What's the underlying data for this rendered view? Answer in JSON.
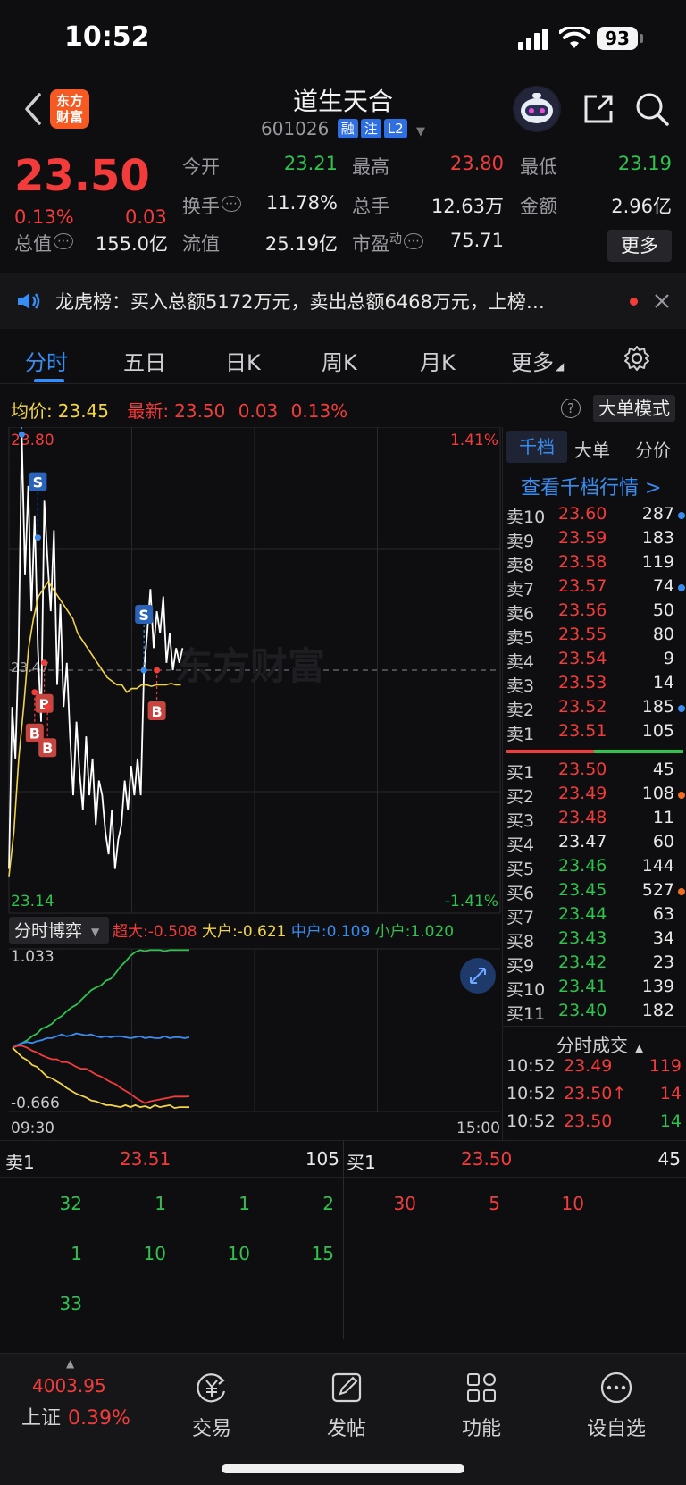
{
  "status_bar": {
    "time": "10:52",
    "battery": "93"
  },
  "header": {
    "logo_line1": "东方",
    "logo_line2": "财富",
    "stock_name": "道生天合",
    "code": "601026",
    "tags": [
      "融",
      "注",
      "L2"
    ]
  },
  "quote": {
    "last": "23.50",
    "pct": "0.13%",
    "chg": "0.03",
    "fields": [
      {
        "label": "今开",
        "value": "23.21",
        "color": "green"
      },
      {
        "label": "最高",
        "value": "23.80",
        "color": "red"
      },
      {
        "label": "最低",
        "value": "23.19",
        "color": "green"
      },
      {
        "label": "换手",
        "value": "11.78%",
        "color": "white"
      },
      {
        "label": "总手",
        "value": "12.63万",
        "color": "white"
      },
      {
        "label": "金额",
        "value": "2.96亿",
        "color": "white"
      },
      {
        "label": "总值",
        "value": "155.0亿",
        "color": "white"
      },
      {
        "label": "流值",
        "value": "25.19亿",
        "color": "white"
      },
      {
        "label": "市盈",
        "value": "75.71",
        "color": "white"
      }
    ],
    "pe_superscript": "动",
    "more_label": "更多"
  },
  "news": {
    "text": "龙虎榜：买入总额5172万元，卖出总额6468万元，上榜…"
  },
  "tabs": [
    "分时",
    "五日",
    "日K",
    "周K",
    "月K",
    "更多"
  ],
  "avg_bar": {
    "avg_label": "均价:",
    "avg_value": "23.45",
    "latest_label": "最新:",
    "latest_value": "23.50",
    "latest_chg": "0.03",
    "latest_pct": "0.13%",
    "help": "?",
    "big_mode": "大单模式"
  },
  "chart_data": {
    "type": "line",
    "title": "",
    "x_start": "09:30",
    "x_end": "15:00",
    "price_top": "23.80",
    "price_bottom": "23.14",
    "price_mid": "23.47",
    "pct_top": "1.41%",
    "pct_bottom": "-1.41%",
    "ylim": [
      23.14,
      23.8
    ],
    "series": [
      {
        "name": "",
        "color": "#ffffff",
        "values": [
          23.2,
          23.42,
          23.35,
          23.5,
          23.79,
          23.6,
          23.72,
          23.55,
          23.68,
          23.5,
          23.4,
          23.7,
          23.62,
          23.55,
          23.66,
          23.45,
          23.56,
          23.42,
          23.48,
          23.38,
          23.3,
          23.4,
          23.33,
          23.28,
          23.38,
          23.3,
          23.35,
          23.26,
          23.32,
          23.3,
          23.25,
          23.22,
          23.28,
          23.2,
          23.24,
          23.26,
          23.32,
          23.28,
          23.34,
          23.3,
          23.35,
          23.3,
          23.47,
          23.52,
          23.58,
          23.5,
          23.55,
          23.52,
          23.57,
          23.48,
          23.52,
          23.47,
          23.5,
          23.48,
          23.5
        ]
      },
      {
        "name": "",
        "color": "#f1d44a",
        "values": [
          23.19,
          23.25,
          23.35,
          23.42,
          23.5,
          23.54,
          23.57,
          23.58,
          23.59,
          23.58,
          23.57,
          23.56,
          23.55,
          23.54,
          23.52,
          23.51,
          23.5,
          23.49,
          23.48,
          23.47,
          23.46,
          23.455,
          23.45,
          23.45,
          23.44,
          23.445,
          23.445,
          23.45,
          23.45,
          23.448,
          23.45,
          23.45,
          23.45,
          23.452,
          23.45,
          23.45
        ]
      }
    ],
    "markers": [
      {
        "type": "S",
        "price": 23.79,
        "idx": 4
      },
      {
        "type": "S",
        "price": 23.65,
        "idx": 9
      },
      {
        "type": "S",
        "price": 23.47,
        "idx": 42
      },
      {
        "type": "B",
        "price": 23.44,
        "idx": 8
      },
      {
        "type": "B",
        "price": 23.48,
        "idx": 11
      },
      {
        "type": "B",
        "price": 23.42,
        "idx": 12
      },
      {
        "type": "B",
        "price": 23.47,
        "idx": 46
      }
    ]
  },
  "flow": {
    "title": "分时博弈",
    "super_label": "超大:",
    "super_value": "-0.508",
    "large_label": "大户:",
    "large_value": "-0.621",
    "mid_label": "中户:",
    "mid_value": "0.109",
    "small_label": "小户:",
    "small_value": "1.020",
    "top": "1.033",
    "bottom": "-0.666",
    "chart_data": {
      "type": "line",
      "ylim": [
        -0.666,
        1.033
      ],
      "series": [
        {
          "name": "小户",
          "color": "#2fc24e",
          "values": [
            0,
            0.02,
            0.05,
            0.08,
            0.12,
            0.15,
            0.2,
            0.22,
            0.25,
            0.3,
            0.33,
            0.38,
            0.42,
            0.45,
            0.5,
            0.55,
            0.6,
            0.63,
            0.65,
            0.7,
            0.72,
            0.78,
            0.85,
            0.9,
            0.96,
            1.0,
            1.02,
            1.01,
            1.02,
            1.02,
            1.02,
            1.01,
            1.02,
            1.02,
            1.02,
            1.02,
            1.02
          ]
        },
        {
          "name": "中户",
          "color": "#3a8df0",
          "values": [
            0,
            0.03,
            0.05,
            0.06,
            0.05,
            0.07,
            0.08,
            0.1,
            0.1,
            0.12,
            0.14,
            0.12,
            0.13,
            0.15,
            0.14,
            0.13,
            0.14,
            0.12,
            0.11,
            0.12,
            0.11,
            0.12,
            0.12,
            0.11,
            0.1,
            0.11,
            0.12,
            0.1,
            0.11,
            0.1,
            0.1,
            0.12,
            0.1,
            0.11,
            0.11,
            0.1,
            0.11
          ]
        },
        {
          "name": "超大",
          "color": "#f23c3c",
          "values": [
            0,
            0.02,
            0.02,
            0.0,
            -0.03,
            -0.05,
            -0.08,
            -0.1,
            -0.12,
            -0.12,
            -0.15,
            -0.15,
            -0.17,
            -0.2,
            -0.22,
            -0.22,
            -0.25,
            -0.28,
            -0.3,
            -0.33,
            -0.36,
            -0.38,
            -0.42,
            -0.45,
            -0.48,
            -0.52,
            -0.55,
            -0.58,
            -0.56,
            -0.55,
            -0.54,
            -0.53,
            -0.52,
            -0.51,
            -0.51,
            -0.51,
            -0.508
          ]
        },
        {
          "name": "大户",
          "color": "#f1d44a",
          "values": [
            0,
            -0.05,
            -0.1,
            -0.13,
            -0.18,
            -0.2,
            -0.25,
            -0.3,
            -0.32,
            -0.35,
            -0.38,
            -0.42,
            -0.45,
            -0.48,
            -0.5,
            -0.52,
            -0.55,
            -0.56,
            -0.58,
            -0.6,
            -0.6,
            -0.61,
            -0.62,
            -0.6,
            -0.62,
            -0.6,
            -0.62,
            -0.61,
            -0.63,
            -0.6,
            -0.62,
            -0.61,
            -0.6,
            -0.63,
            -0.62,
            -0.62,
            -0.621
          ]
        }
      ]
    }
  },
  "order_book": {
    "tabs": [
      "千档",
      "大单",
      "分价"
    ],
    "link": "查看千档行情 >",
    "asks": [
      {
        "label": "卖10",
        "price": "23.60",
        "vol": "287",
        "dot": "#3a8df0"
      },
      {
        "label": "卖9",
        "price": "23.59",
        "vol": "183",
        "dot": ""
      },
      {
        "label": "卖8",
        "price": "23.58",
        "vol": "119",
        "dot": ""
      },
      {
        "label": "卖7",
        "price": "23.57",
        "vol": "74",
        "dot": "#3a8df0"
      },
      {
        "label": "卖6",
        "price": "23.56",
        "vol": "50",
        "dot": ""
      },
      {
        "label": "卖5",
        "price": "23.55",
        "vol": "80",
        "dot": ""
      },
      {
        "label": "卖4",
        "price": "23.54",
        "vol": "9",
        "dot": ""
      },
      {
        "label": "卖3",
        "price": "23.53",
        "vol": "14",
        "dot": ""
      },
      {
        "label": "卖2",
        "price": "23.52",
        "vol": "185",
        "dot": "#3a8df0"
      },
      {
        "label": "卖1",
        "price": "23.51",
        "vol": "105",
        "dot": ""
      }
    ],
    "bids": [
      {
        "label": "买1",
        "price": "23.50",
        "vol": "45",
        "dot": "",
        "color": "red"
      },
      {
        "label": "买2",
        "price": "23.49",
        "vol": "108",
        "dot": "#f07020",
        "color": "red"
      },
      {
        "label": "买3",
        "price": "23.48",
        "vol": "11",
        "dot": "",
        "color": "red"
      },
      {
        "label": "买4",
        "price": "23.47",
        "vol": "60",
        "dot": "",
        "color": "white"
      },
      {
        "label": "买5",
        "price": "23.46",
        "vol": "144",
        "dot": "",
        "color": "green"
      },
      {
        "label": "买6",
        "price": "23.45",
        "vol": "527",
        "dot": "#f07020",
        "color": "green"
      },
      {
        "label": "买7",
        "price": "23.44",
        "vol": "63",
        "dot": "",
        "color": "green"
      },
      {
        "label": "买8",
        "price": "23.43",
        "vol": "34",
        "dot": "",
        "color": "green"
      },
      {
        "label": "买9",
        "price": "23.42",
        "vol": "23",
        "dot": "",
        "color": "green"
      },
      {
        "label": "买10",
        "price": "23.41",
        "vol": "139",
        "dot": "",
        "color": "green"
      },
      {
        "label": "买11",
        "price": "23.40",
        "vol": "182",
        "dot": "",
        "color": "green"
      }
    ],
    "trades_title": "分时成交",
    "trades": [
      {
        "time": "10:52",
        "price": "23.49",
        "vol": "119",
        "pcolor": "red",
        "vcolor": "red"
      },
      {
        "time": "10:52",
        "price": "23.50↑",
        "vol": "14",
        "pcolor": "red",
        "vcolor": "red"
      },
      {
        "time": "10:52",
        "price": "23.50",
        "vol": "14",
        "pcolor": "red",
        "vcolor": "green"
      }
    ]
  },
  "queue": {
    "ask_label": "卖1",
    "ask_price": "23.51",
    "ask_vol": "105",
    "bid_label": "买1",
    "bid_price": "23.50",
    "bid_vol": "45",
    "ask_cells": [
      [
        "32",
        "1",
        "1",
        "2"
      ],
      [
        "1",
        "10",
        "10",
        "15"
      ],
      [
        "33",
        "",
        "",
        ""
      ]
    ],
    "bid_cells": [
      [
        "30",
        "5",
        "10"
      ]
    ]
  },
  "bottom_nav": {
    "index_value": "4003.95",
    "index_name": "上证",
    "index_pct": "0.39%",
    "items": [
      {
        "label": "交易",
        "icon": "yuan-exchange-icon"
      },
      {
        "label": "发帖",
        "icon": "edit-post-icon"
      },
      {
        "label": "功能",
        "icon": "grid-apps-icon"
      },
      {
        "label": "设自选",
        "icon": "more-dots-icon"
      }
    ]
  },
  "watermark": "东方财富"
}
